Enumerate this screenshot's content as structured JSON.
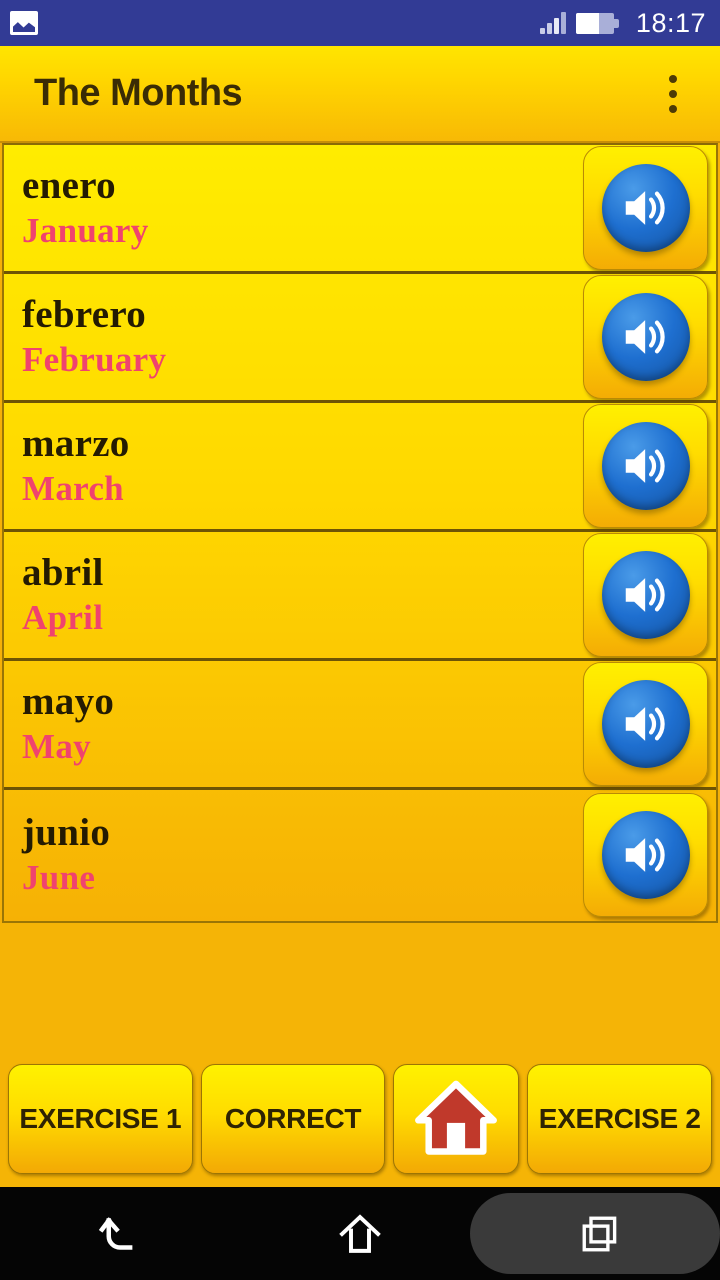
{
  "status_bar": {
    "notification_icon": "image-icon",
    "signal_icon": "signal-bars-icon",
    "battery_icon": "battery-icon",
    "battery_level_percent": 62,
    "time": "18:17"
  },
  "action_bar": {
    "title": "The Months",
    "overflow_icon": "overflow-menu-icon"
  },
  "list": {
    "speaker_icon": "speaker-icon",
    "items": [
      {
        "native": "enero",
        "translation": "January"
      },
      {
        "native": "febrero",
        "translation": "February"
      },
      {
        "native": "marzo",
        "translation": "March"
      },
      {
        "native": "abril",
        "translation": "April"
      },
      {
        "native": "mayo",
        "translation": "May"
      },
      {
        "native": "junio",
        "translation": "June"
      }
    ]
  },
  "bottom_bar": {
    "exercise1_label": "EXERCISE 1",
    "correct_label": "CORRECT",
    "home_icon": "home-house-icon",
    "exercise2_label": "EXERCISE 2"
  },
  "nav_bar": {
    "back_icon": "back-arrow-icon",
    "home_icon": "home-outline-icon",
    "recents_icon": "recents-squares-icon"
  },
  "colors": {
    "status_bar_bg": "#323B95",
    "action_bar_top": "#FFE500",
    "action_bar_bottom": "#F8B905",
    "list_top": "#FFEC00",
    "list_bottom": "#F6B105",
    "native_text": "#241B02",
    "translation_text": "#F0436E",
    "speaker_blue": "#1E6FD0",
    "home_red": "#C0392B",
    "nav_bar_bg": "#050505"
  }
}
